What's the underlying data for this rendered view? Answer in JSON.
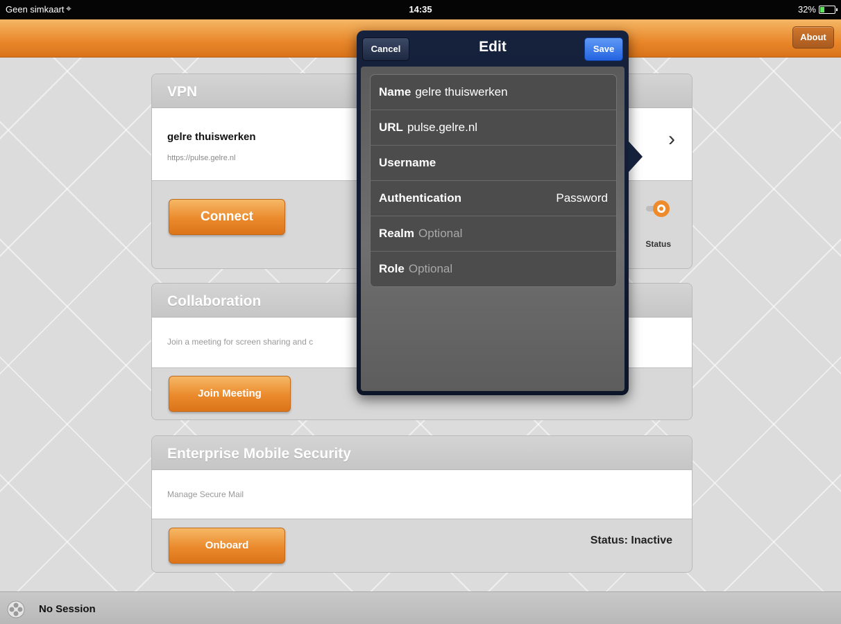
{
  "statusbar": {
    "carrier": "Geen simkaart",
    "time": "14:35",
    "battery": "32%"
  },
  "navbar": {
    "about": "About"
  },
  "vpn": {
    "title": "VPN",
    "connection_name": "gelre thuiswerken",
    "connection_url": "https://pulse.gelre.nl",
    "connect_label": "Connect",
    "status_label": "Status"
  },
  "collaboration": {
    "title": "Collaboration",
    "description": "Join a meeting for screen sharing and c",
    "join_label": "Join Meeting"
  },
  "ems": {
    "title": "Enterprise Mobile Security",
    "description": "Manage Secure Mail",
    "onboard_label": "Onboard",
    "status_text": "Status: Inactive"
  },
  "bottombar": {
    "session": "No Session"
  },
  "edit_popover": {
    "title": "Edit",
    "cancel": "Cancel",
    "save": "Save",
    "fields": {
      "name": {
        "label": "Name",
        "value": "gelre thuiswerken"
      },
      "url": {
        "label": "URL",
        "value": "pulse.gelre.nl"
      },
      "username": {
        "label": "Username",
        "value": ""
      },
      "authentication": {
        "label": "Authentication",
        "value": "Password"
      },
      "realm": {
        "label": "Realm",
        "placeholder": "Optional"
      },
      "role": {
        "label": "Role",
        "placeholder": "Optional"
      }
    }
  },
  "colors": {
    "accent_orange": "#ea8a2c",
    "save_blue": "#2463e0",
    "popover_navy": "#16223d"
  }
}
